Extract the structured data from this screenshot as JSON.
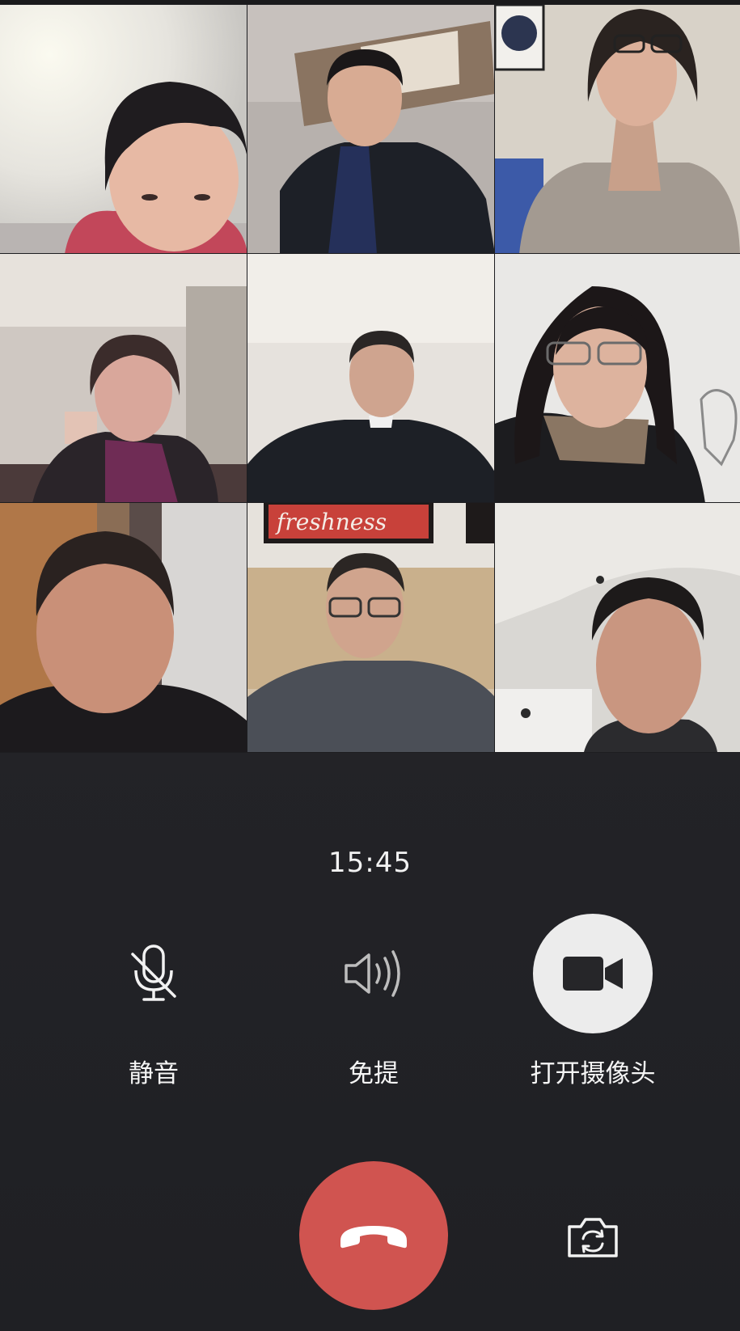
{
  "call": {
    "timer": "15:45",
    "participant_count": 9
  },
  "controls": {
    "mute_label": "静音",
    "speaker_label": "免提",
    "camera_label": "打开摄像头",
    "mute_icon": "microphone-off-icon",
    "speaker_icon": "speaker-icon",
    "camera_icon": "video-camera-icon",
    "hangup_icon": "phone-hangup-icon",
    "switch_camera_icon": "camera-switch-icon"
  },
  "video_tiles": [
    {
      "sign_text": ""
    },
    {
      "sign_text": ""
    },
    {
      "sign_text": ""
    },
    {
      "sign_text": ""
    },
    {
      "sign_text": ""
    },
    {
      "sign_text": ""
    },
    {
      "sign_text": ""
    },
    {
      "sign_text": "freshness"
    },
    {
      "sign_text": ""
    }
  ],
  "colors": {
    "background": "#232327",
    "hangup": "#d05450",
    "camera_button": "#ececec",
    "text": "#f5f5f5"
  }
}
